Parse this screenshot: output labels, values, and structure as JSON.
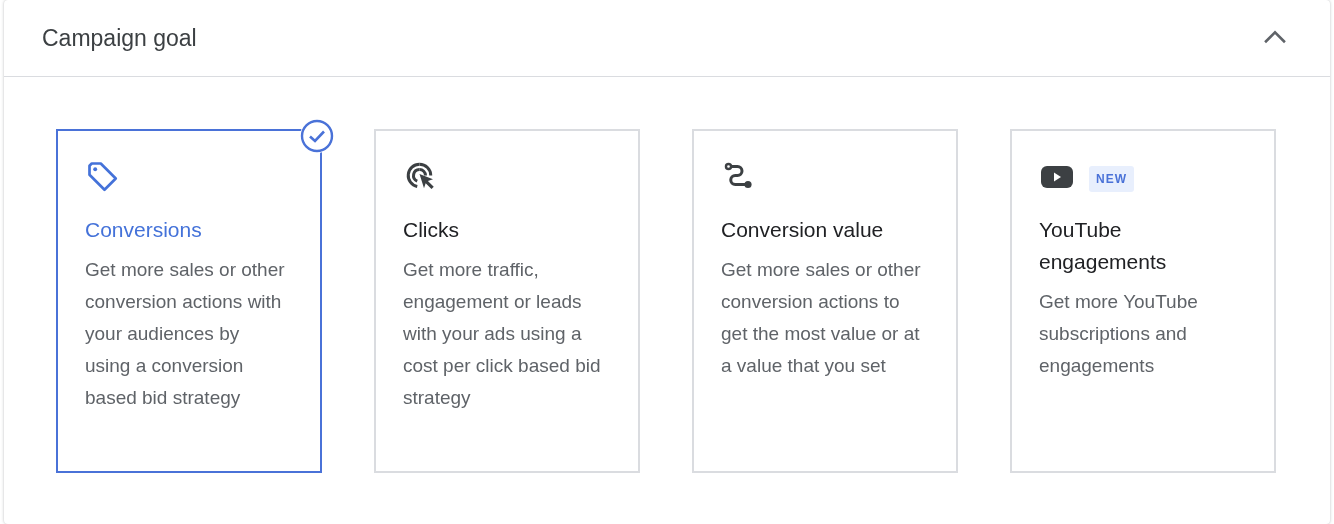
{
  "panel": {
    "title": "Campaign goal",
    "expanded": true
  },
  "goals": [
    {
      "title": "Conversions",
      "description": "Get more sales or other conversion actions with your audiences by using a conversion based bid strategy",
      "selected": true
    },
    {
      "title": "Clicks",
      "description": "Get more traffic, engagement or leads with your ads using a cost per click based bid strategy",
      "selected": false
    },
    {
      "title": "Conversion value",
      "description": "Get more sales or other conversion actions to get the most value or at a value that you set",
      "selected": false
    },
    {
      "title": "YouTube engagements",
      "badge": "NEW",
      "description": "Get more YouTube subscriptions and engagements",
      "selected": false
    }
  ]
}
